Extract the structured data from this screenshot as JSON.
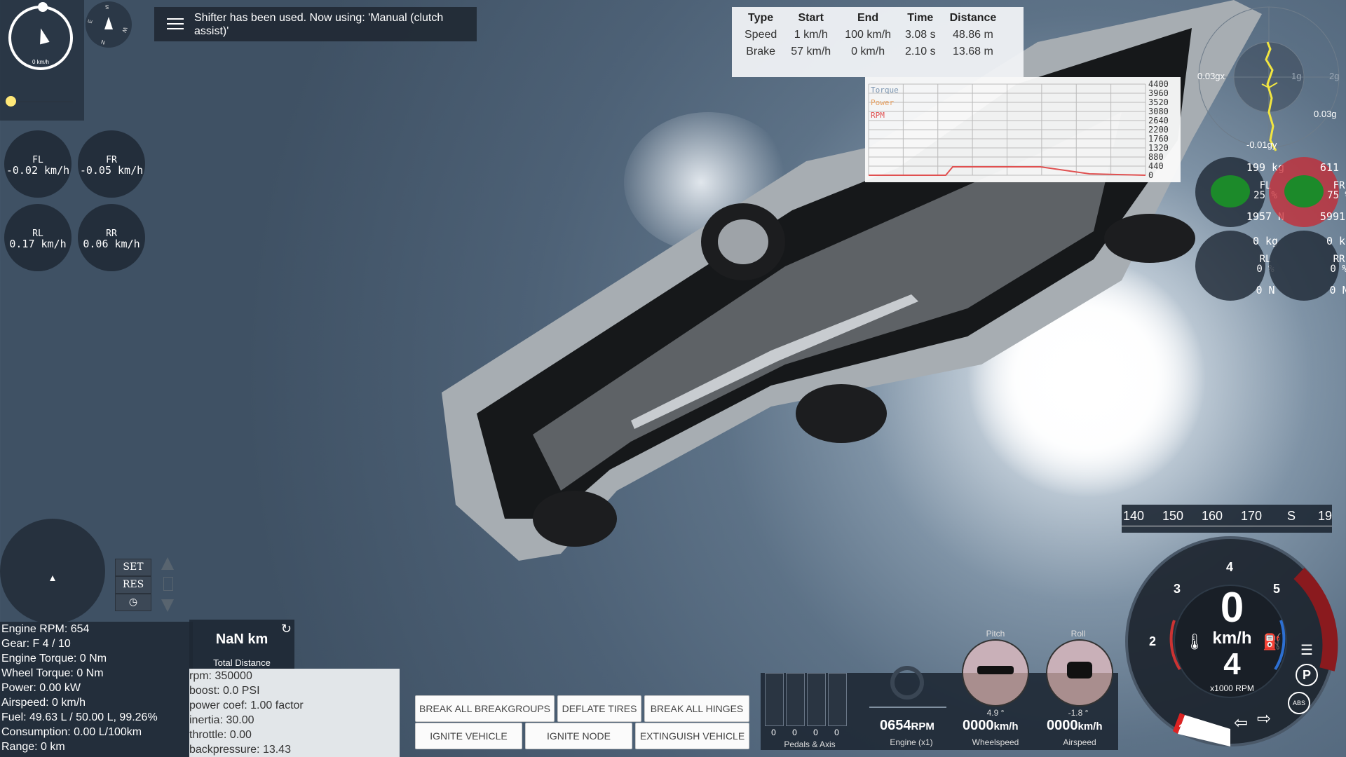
{
  "notification": {
    "message": "Shifter has been used. Now using: 'Manual (clutch assist)'"
  },
  "mini_speedo": {
    "unit": "0 km/h"
  },
  "compass": {
    "n": "N",
    "e": "E",
    "s": "S",
    "w": "W"
  },
  "wheel_speeds": [
    {
      "name": "FL",
      "value": "-0.02 km/h"
    },
    {
      "name": "FR",
      "value": "-0.05 km/h"
    },
    {
      "name": "RL",
      "value": "0.17 km/h"
    },
    {
      "name": "RR",
      "value": "0.06 km/h"
    }
  ],
  "timing_table": {
    "headers": [
      "Type",
      "Start",
      "End",
      "Time",
      "Distance"
    ],
    "rows": [
      [
        "Speed",
        "1 km/h",
        "100 km/h",
        "3.08 s",
        "48.86 m"
      ],
      [
        "Brake",
        "57 km/h",
        "0 km/h",
        "2.10 s",
        "13.68 m"
      ]
    ]
  },
  "torque_graph": {
    "legend": [
      "Torque",
      "Power",
      "RPM"
    ],
    "y_ticks": [
      "4400",
      "3960",
      "3520",
      "3080",
      "2640",
      "2200",
      "1760",
      "1320",
      "880",
      "440",
      "0"
    ],
    "colors": {
      "torque": "#7a94b0",
      "power": "#e8a060",
      "rpm": "#e05050"
    }
  },
  "gforce": {
    "x_label": "0.03gx",
    "y_label": "-0.01gy",
    "one_g": "1g",
    "two_g": "2g",
    "right_label": "0.03g"
  },
  "weight_distribution": [
    {
      "name": "FL",
      "mass": "199 kg",
      "percent": "25 %",
      "force": "1957 N"
    },
    {
      "name": "FR",
      "mass": "611 kg",
      "percent": "75 %",
      "force": "5991 N"
    },
    {
      "name": "RL",
      "mass": "0 kg",
      "percent": "0 %",
      "force": "0 N"
    },
    {
      "name": "RR",
      "mass": "0 kg",
      "percent": "0 %",
      "force": "0 N"
    }
  ],
  "cruise_control": {
    "set": "SET",
    "res": "RES"
  },
  "stats": {
    "lines": [
      "Engine RPM: 654",
      "Gear: F 4 / 10",
      "Engine Torque: 0 Nm",
      "Wheel Torque: 0 Nm",
      "Power: 0.00 kW",
      "Airspeed: 0 km/h",
      "Fuel: 49.63 L / 50.00 L, 99.26%",
      "Consumption: 0.00 L/100km",
      "Range: 0 km"
    ]
  },
  "distance": {
    "value": "NaN km",
    "label": "Total Distance"
  },
  "engine_params": {
    "lines": [
      "rpm: 350000",
      "boost: 0.0 PSI",
      "power coef: 1.00 factor",
      "inertia: 30.00",
      "throttle: 0.00",
      "backpressure: 13.43"
    ]
  },
  "actions": {
    "break_breakgroups": "BREAK ALL BREAKGROUPS",
    "deflate_tires": "DEFLATE TIRES",
    "break_hinges": "BREAK ALL HINGES",
    "ignite_vehicle": "IGNITE VEHICLE",
    "ignite_node": "IGNITE NODE",
    "extinguish_vehicle": "EXTINGUISH VEHICLE"
  },
  "pedals": {
    "values": [
      "0",
      "0",
      "0",
      "0"
    ],
    "label": "Pedals & Axis"
  },
  "readouts": {
    "engine": {
      "value": "0654",
      "unit": "RPM",
      "label": "Engine (x1)"
    },
    "wheelspeed": {
      "value": "0000",
      "unit": "km/h",
      "label": "Wheelspeed"
    },
    "airspeed": {
      "value": "0000",
      "unit": "km/h",
      "label": "Airspeed"
    }
  },
  "tilt": {
    "pitch": {
      "label": "Pitch",
      "angle": "4.9 °"
    },
    "roll": {
      "label": "Roll",
      "angle": "-1.8 °"
    }
  },
  "speed_tape": [
    "140",
    "150",
    "160",
    "170",
    "S",
    "19"
  ],
  "tach": {
    "speed": "0",
    "speed_unit": "km/h",
    "gear": "4",
    "rpm_label": "x1000 RPM",
    "ticks": [
      "1",
      "2",
      "3",
      "4",
      "5"
    ],
    "park": "P",
    "abs": "ABS"
  }
}
